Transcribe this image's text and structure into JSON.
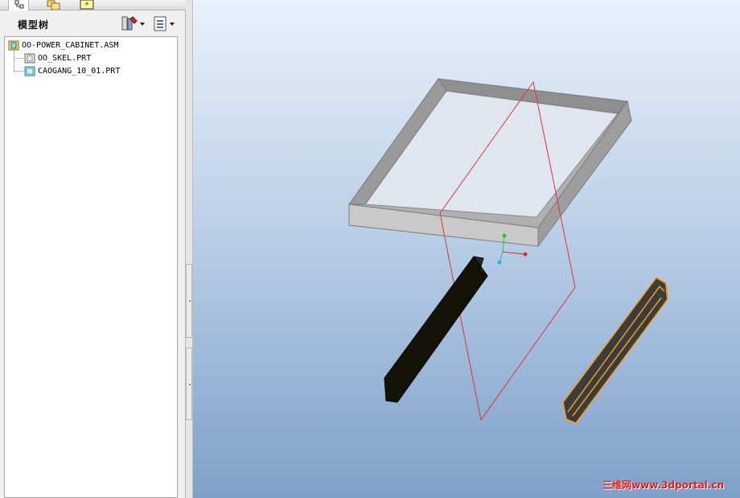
{
  "panel": {
    "title": "模型树",
    "tabs": [
      {
        "icon": "model-tree-icon"
      },
      {
        "icon": "folder-browser-icon"
      },
      {
        "icon": "favorites-icon"
      }
    ],
    "settings_icon": "tree-settings-icon",
    "show_icon": "show-menu-icon"
  },
  "tree": {
    "root": {
      "label": "OO-POWER_CABINET.ASM",
      "icon": "assembly-icon"
    },
    "children": [
      {
        "label": "OO_SKEL.PRT",
        "icon": "skeleton-part-icon"
      },
      {
        "label": "CAOGANG_10_01.PRT",
        "icon": "part-icon"
      }
    ]
  },
  "graphics": {
    "watermark": "三维网www.3dportal.cn",
    "background_top": "#e9f1fb",
    "background_bottom": "#7fa0c9",
    "frame_color": "#a9a9a9",
    "datum_plane_color": "#e0313a",
    "channel_highlight_color": "#f0a020",
    "dark_part_color": "#131308"
  }
}
